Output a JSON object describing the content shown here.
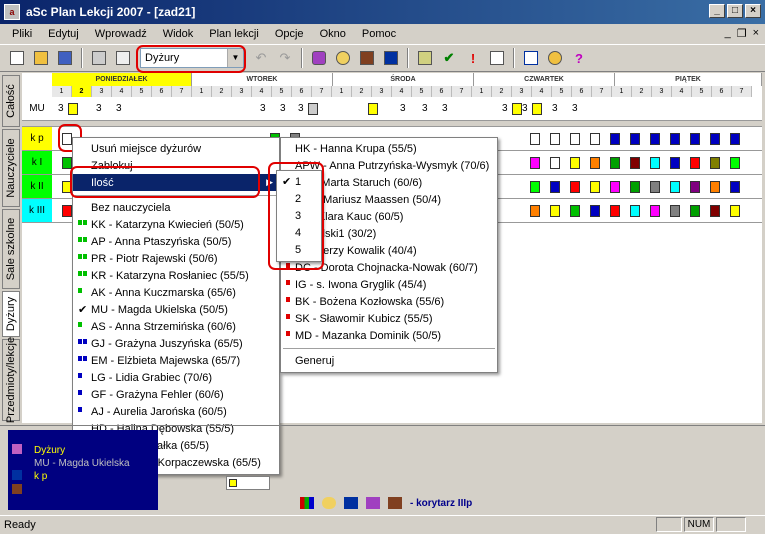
{
  "window": {
    "title": "aSc Plan Lekcji 2007 - [zad21]",
    "minimize": "_",
    "maximize": "□",
    "close": "×"
  },
  "menubar": [
    "Pliki",
    "Edytuj",
    "Wprowadź",
    "Widok",
    "Plan lekcji",
    "Opcje",
    "Okno",
    "Pomoc"
  ],
  "mdi": {
    "minimize": "_",
    "restore": "❐",
    "close": "×"
  },
  "toolbar": {
    "combo_value": "Dyżury",
    "combo_arrow": "▼"
  },
  "sidetabs": [
    "Całość",
    "Nauczyciele",
    "Sale szkolne",
    "Dyżury",
    "Przedmioty/lekcje"
  ],
  "days": [
    "PONIEDZIAŁEK",
    "WTOREK",
    "ŚRODA",
    "CZWARTEK",
    "PIĄTEK"
  ],
  "periods": [
    "1",
    "2",
    "3",
    "4",
    "5",
    "6",
    "7"
  ],
  "rows": [
    {
      "label": "MU",
      "values": [
        "3",
        "3",
        "3",
        "3",
        "3",
        "3",
        "3",
        "3",
        "3",
        "3",
        "3",
        "3",
        "3"
      ]
    },
    {
      "label": "k p"
    },
    {
      "label": "k I"
    },
    {
      "label": "k II"
    },
    {
      "label": "k III"
    }
  ],
  "context_menu": {
    "items": [
      "Usuń miejsce dyżurów",
      "Zablokuj",
      "Ilość",
      "Bez nauczyciela",
      "KK - Katarzyna Kwiecień (50/5)",
      "AP - Anna Ptaszyńska (50/5)",
      "PR - Piotr Rajewski (50/6)",
      "KR - Katarzyna Rosłaniec (55/5)",
      "AK - Anna Kuczmarska (65/6)",
      "MU - Magda Ukielska (50/5)",
      "AS - Anna Strzemińska (60/6)",
      "GJ - Grażyna Juszyńska (65/5)",
      "EM - Elżbieta Majewska (65/7)",
      "LG - Lidia Grabiec (70/6)",
      "GF - Grażyna Fehler (60/6)",
      "AJ - Aurelia Jarońska (60/5)",
      "HD - Halina Dębowska (55/5)",
      "IK - Ilona Kasałka (65/5)",
      "EK - Elżbieta Korpaczewska (65/5)"
    ],
    "submenu_arrow": "▶",
    "checkmark": "✔"
  },
  "teacher_menu": {
    "items": [
      "HK - Hanna Krupa (55/5)",
      "APW - Anna Putrzyńska-Wysmyk (70/6)",
      "MS - Marta Staruch (60/6)",
      "MM - Mariusz Maassen (50/4)",
      "KL - Klara Kauc (60/5)",
      "Kowalski1 (30/2)",
      "JK - Jerzy Kowalik (40/4)",
      "DC - Dorota Chojnacka-Nowak (60/7)",
      "IG - s. Iwona Gryglik (45/4)",
      "BK - Bożena Kozłowska (55/6)",
      "SK - Sławomir Kubicz (55/5)",
      "MD - Mazanka Dominik (50/5)",
      "Generuj"
    ]
  },
  "quantity_menu": {
    "items": [
      "1",
      "2",
      "3",
      "4",
      "5"
    ],
    "checked": "1"
  },
  "info_panel": {
    "lines": [
      "Dyżury",
      "MU - Magda Ukielska",
      "k p"
    ]
  },
  "bottom_tab_label": "- korytarz IIIp",
  "status": {
    "text": "Ready",
    "num": "NUM"
  },
  "colors": {
    "highlight": "#0a246a",
    "annotation": "#e00000",
    "cyan": "#00ffff",
    "yellow": "#ffff00"
  }
}
